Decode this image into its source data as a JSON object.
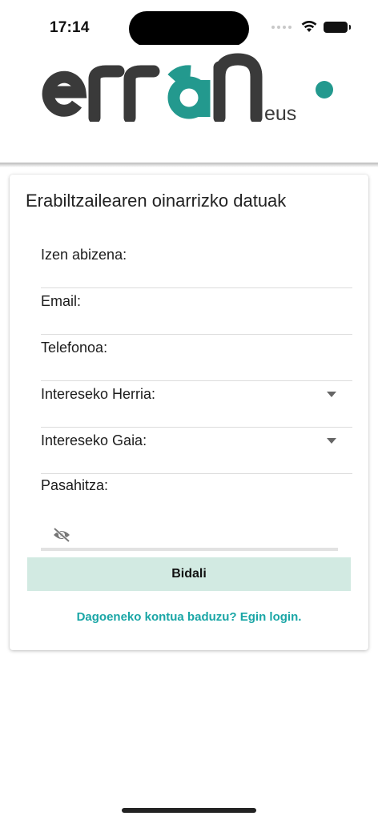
{
  "status_bar": {
    "time": "17:14"
  },
  "logo": {
    "text_main": "erran",
    "text_suffix": "eus",
    "colors": {
      "dark": "#3a3a3a",
      "teal": "#23998e"
    }
  },
  "form": {
    "title": "Erabiltzailearen oinarrizko datuak",
    "fields": [
      {
        "label": "Izen abizena:"
      },
      {
        "label": "Email:"
      },
      {
        "label": "Telefonoa:"
      },
      {
        "label": "Intereseko Herria:"
      },
      {
        "label": "Intereseko Gaia:"
      }
    ],
    "password": {
      "label": "Pasahitza:",
      "icon": "eye-off-icon"
    },
    "submit_label": "Bidali",
    "login_link": "Dagoeneko kontua baduzu? Egin login."
  },
  "colors": {
    "accent": "#1aa6a6",
    "button_bg": "#d2eae2"
  }
}
